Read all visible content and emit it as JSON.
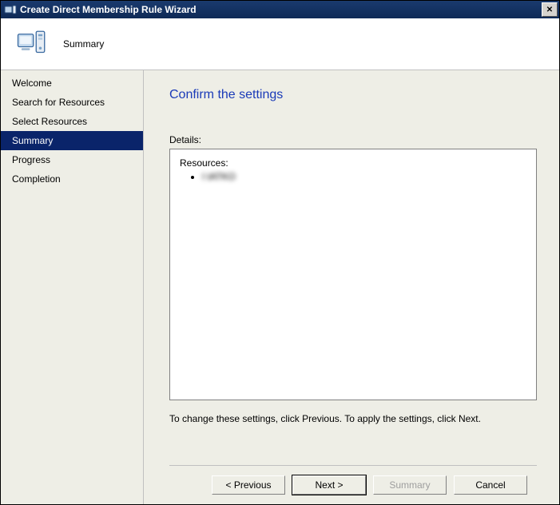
{
  "window": {
    "title": "Create Direct Membership Rule Wizard",
    "close_label": "✕"
  },
  "header": {
    "title": "Summary"
  },
  "sidebar": {
    "items": [
      {
        "label": "Welcome",
        "active": false
      },
      {
        "label": "Search for Resources",
        "active": false
      },
      {
        "label": "Select Resources",
        "active": false
      },
      {
        "label": "Summary",
        "active": true
      },
      {
        "label": "Progress",
        "active": false
      },
      {
        "label": "Completion",
        "active": false
      }
    ]
  },
  "main": {
    "page_title": "Confirm the settings",
    "details_label": "Details:",
    "resources_label": "Resources:",
    "resources": [
      "I  tATKO"
    ],
    "hint_text": "To change these settings, click Previous. To apply the settings, click Next."
  },
  "buttons": {
    "previous": "< Previous",
    "next": "Next >",
    "summary": "Summary",
    "cancel": "Cancel"
  }
}
